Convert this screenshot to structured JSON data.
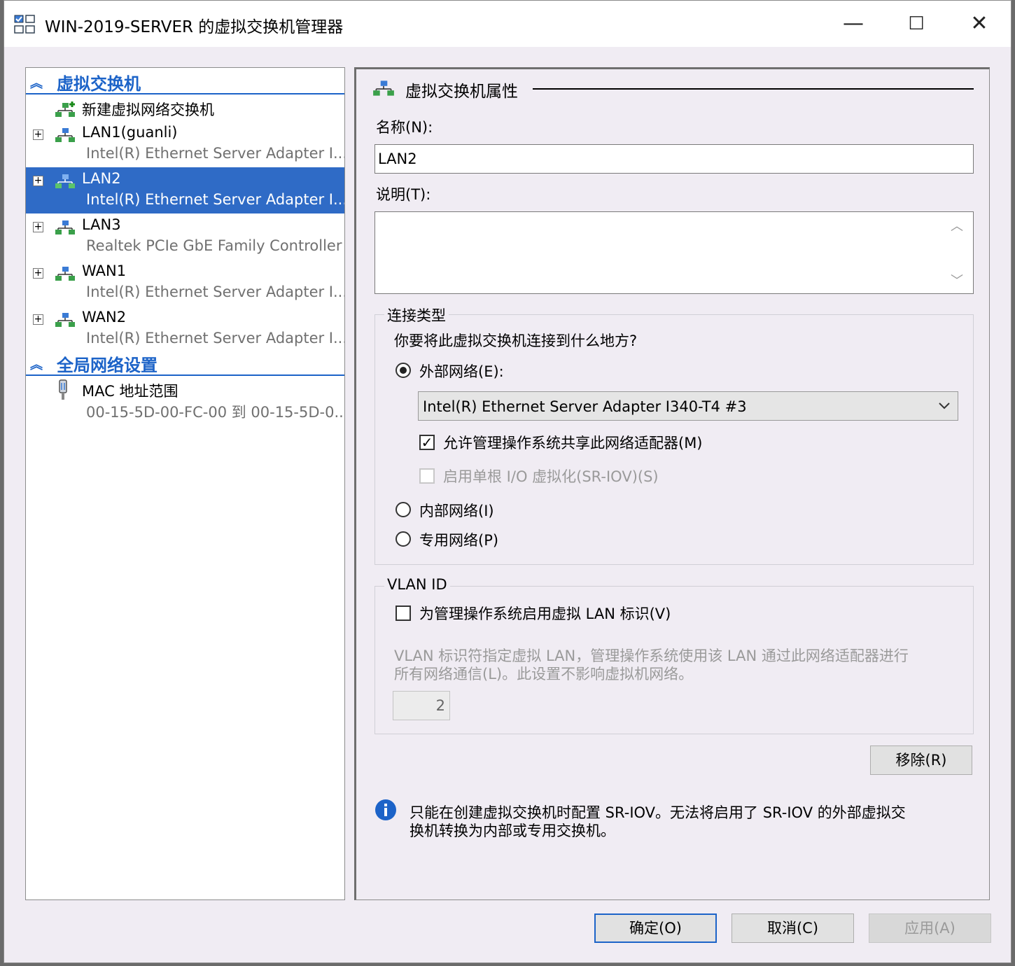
{
  "window": {
    "title": "WIN-2019-SERVER 的虚拟交换机管理器",
    "minimize_label": "—",
    "maximize_label": "☐",
    "close_label": "✕"
  },
  "tree": {
    "section1": "虚拟交换机",
    "new_switch": "新建虚拟网络交换机",
    "switches": [
      {
        "name": "LAN1(guanli)",
        "adapter": "Intel(R) Ethernet Server Adapter I..."
      },
      {
        "name": "LAN2",
        "adapter": "Intel(R) Ethernet Server Adapter I..."
      },
      {
        "name": "LAN3",
        "adapter": "Realtek PCIe GbE Family Controller"
      },
      {
        "name": "WAN1",
        "adapter": "Intel(R) Ethernet Server Adapter I..."
      },
      {
        "name": "WAN2",
        "adapter": "Intel(R) Ethernet Server Adapter I..."
      }
    ],
    "section2": "全局网络设置",
    "mac": {
      "name": "MAC 地址范围",
      "range": "00-15-5D-00-FC-00 到 00-15-5D-0..."
    }
  },
  "props": {
    "header": "虚拟交换机属性",
    "name_label": "名称(N):",
    "name_value": "LAN2",
    "desc_label": "说明(T):",
    "conn": {
      "title": "连接类型",
      "question": "你要将此虚拟交换机连接到什么地方?",
      "external": "外部网络(E):",
      "adapter_selected": "Intel(R) Ethernet Server Adapter I340-T4 #3",
      "allow_mgmt": "允许管理操作系统共享此网络适配器(M)",
      "sriov": "启用单根 I/O 虚拟化(SR-IOV)(S)",
      "internal": "内部网络(I)",
      "private": "专用网络(P)"
    },
    "vlan": {
      "title": "VLAN ID",
      "enable": "为管理操作系统启用虚拟 LAN 标识(V)",
      "desc_line1": "VLAN 标识符指定虚拟 LAN，管理操作系统使用该 LAN 通过此网络适配器进行",
      "desc_line2": "所有网络通信(L)。此设置不影响虚拟机网络。",
      "value": "2"
    },
    "remove": "移除(R)",
    "info_line1": "只能在创建虚拟交换机时配置 SR-IOV。无法将启用了 SR-IOV 的外部虚拟交",
    "info_line2": "换机转换为内部或专用交换机。"
  },
  "buttons": {
    "ok": "确定(O)",
    "cancel": "取消(C)",
    "apply": "应用(A)"
  },
  "colors": {
    "accent": "#2f6bc6",
    "section": "#1c63c8",
    "info": "#1c63c8"
  }
}
